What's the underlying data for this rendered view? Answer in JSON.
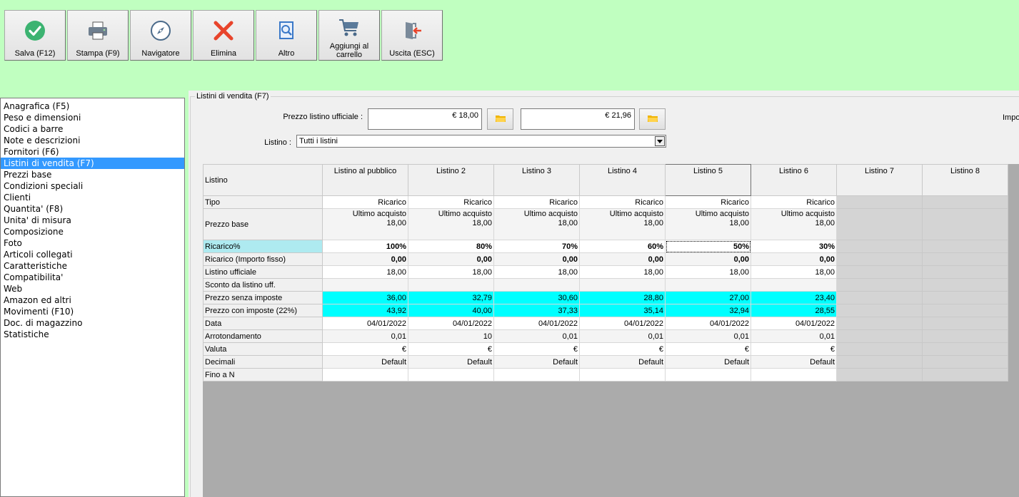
{
  "toolbar": [
    {
      "label": "Salva (F12)",
      "icon": "check-icon"
    },
    {
      "label": "Stampa (F9)",
      "icon": "printer-icon"
    },
    {
      "label": "Navigatore",
      "icon": "compass-icon"
    },
    {
      "label": "Elimina",
      "icon": "delete-x-icon"
    },
    {
      "label": "Altro",
      "icon": "search-document-icon"
    },
    {
      "label": "Aggiungi al carrello",
      "icon": "cart-icon"
    },
    {
      "label": "Uscita (ESC)",
      "icon": "exit-door-icon"
    }
  ],
  "nav": {
    "items": [
      "Anagrafica (F5)",
      "Peso e dimensioni",
      "Codici a barre",
      "Note e descrizioni",
      "Fornitori (F6)",
      "Listini di vendita (F7)",
      "Prezzi base",
      "Condizioni speciali",
      "Clienti",
      "Quantita' (F8)",
      "Unita' di misura",
      "Composizione",
      "Foto",
      "Articoli collegati",
      "Caratteristiche",
      "Compatibilita'",
      "Web",
      "Amazon ed altri",
      "Movimenti (F10)",
      "Doc. di magazzino",
      "Statistiche"
    ],
    "selected": "Listini di vendita (F7)"
  },
  "panel": {
    "title": "Listini di vendita (F7)",
    "prezzo_label": "Prezzo listino ufficiale :",
    "prezzo_value": "€ 18,00",
    "prezzo_ivato": "€ 21,96",
    "listino_label": "Listino :",
    "listino_value": "Tutti i listini",
    "right_cut_label": "Impo"
  },
  "grid": {
    "corner": "Listino",
    "columns": [
      "Listino al pubblico",
      "Listino 2",
      "Listino 3",
      "Listino 4",
      "Listino 5",
      "Listino 6",
      "Listino 7",
      "Listino 8"
    ],
    "active_column": "Listino 5",
    "rows": {
      "tipo": {
        "label": "Tipo",
        "values": [
          "Ricarico",
          "Ricarico",
          "Ricarico",
          "Ricarico",
          "Ricarico",
          "Ricarico"
        ]
      },
      "prezzo_base": {
        "label": "Prezzo base",
        "line1": [
          "Ultimo acquisto",
          "Ultimo acquisto",
          "Ultimo acquisto",
          "Ultimo acquisto",
          "Ultimo acquisto",
          "Ultimo acquisto"
        ],
        "line2": [
          "18,00",
          "18,00",
          "18,00",
          "18,00",
          "18,00",
          "18,00"
        ]
      },
      "ricarico_pct": {
        "label": "Ricarico%",
        "values": [
          "100%",
          "80%",
          "70%",
          "60%",
          "50%",
          "30%"
        ]
      },
      "ricarico_fisso": {
        "label": "Ricarico (Importo fisso)",
        "values": [
          "0,00",
          "0,00",
          "0,00",
          "0,00",
          "0,00",
          "0,00"
        ]
      },
      "listino_ufficiale": {
        "label": "Listino ufficiale",
        "values": [
          "18,00",
          "18,00",
          "18,00",
          "18,00",
          "18,00",
          "18,00"
        ]
      },
      "sconto": {
        "label": "Sconto da listino uff.",
        "values": [
          "",
          "",
          "",
          "",
          "",
          ""
        ]
      },
      "senza_imposte": {
        "label": "Prezzo senza imposte",
        "values": [
          "36,00",
          "32,79",
          "30,60",
          "28,80",
          "27,00",
          "23,40"
        ]
      },
      "con_imposte": {
        "label": "Prezzo con imposte (22%)",
        "values": [
          "43,92",
          "40,00",
          "37,33",
          "35,14",
          "32,94",
          "28,55"
        ]
      },
      "data": {
        "label": "Data",
        "values": [
          "04/01/2022",
          "04/01/2022",
          "04/01/2022",
          "04/01/2022",
          "04/01/2022",
          "04/01/2022"
        ]
      },
      "arrotondamento": {
        "label": "Arrotondamento",
        "values": [
          "0,01",
          "10",
          "0,01",
          "0,01",
          "0,01",
          "0,01"
        ]
      },
      "valuta": {
        "label": "Valuta",
        "values": [
          "€",
          "€",
          "€",
          "€",
          "€",
          "€"
        ]
      },
      "decimali": {
        "label": "Decimali",
        "values": [
          "Default",
          "Default",
          "Default",
          "Default",
          "Default",
          "Default"
        ]
      },
      "fino_a": {
        "label": "Fino a N",
        "values": [
          "",
          "",
          "",
          "",
          "",
          ""
        ]
      }
    }
  },
  "colors": {
    "background": "#c0ffc0",
    "selection": "#3399ff",
    "price_highlight": "#00ffff",
    "ricarico_header": "#aeeaf0"
  }
}
